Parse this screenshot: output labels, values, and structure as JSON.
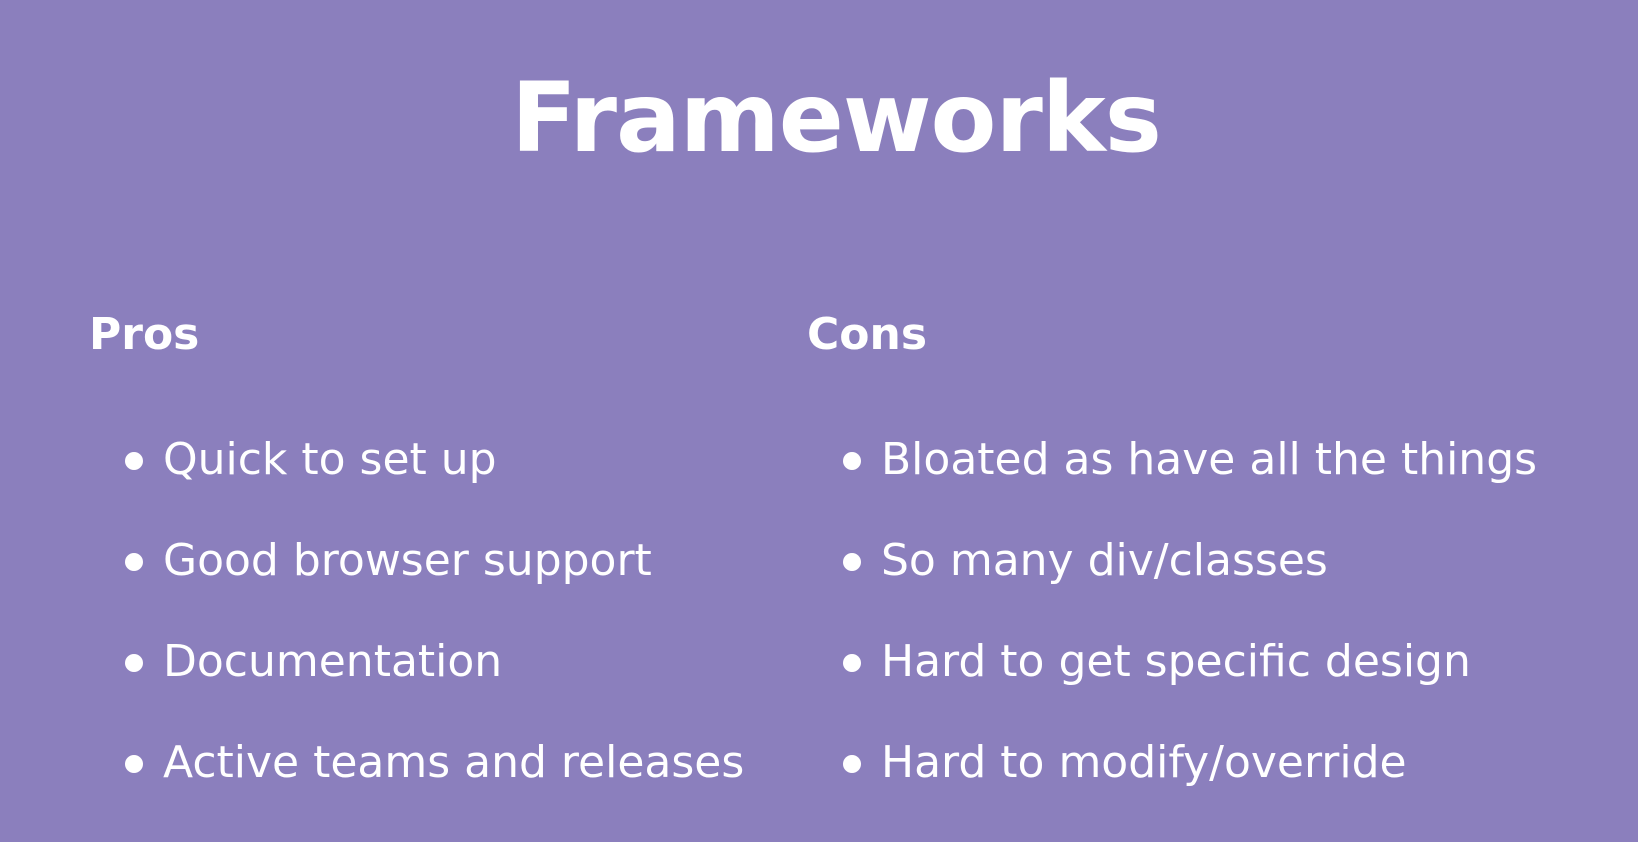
{
  "title": "Frameworks",
  "pros": {
    "heading": "Pros",
    "items": [
      "Quick to set up",
      "Good browser support",
      "Documentation",
      "Active teams and releases"
    ]
  },
  "cons": {
    "heading": "Cons",
    "items": [
      "Bloated as have all the things",
      "So many div/classes",
      "Hard to get specific design",
      "Hard to modify/override"
    ]
  }
}
